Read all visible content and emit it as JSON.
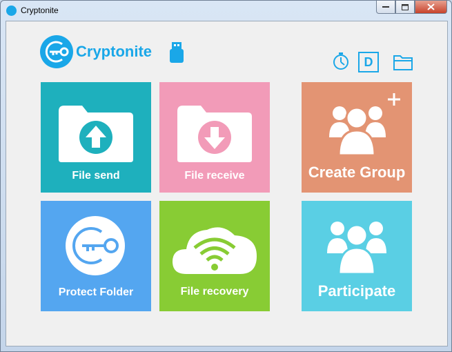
{
  "window": {
    "title": "Cryptonite"
  },
  "logo": {
    "text": "Cryptonite"
  },
  "toolbar": {
    "drive_letter": "D"
  },
  "tiles": {
    "file_send": "File send",
    "file_receive": "File receive",
    "create_group": "Create Group",
    "protect_folder": "Protect Folder",
    "file_recovery": "File recovery",
    "participate": "Participate"
  },
  "colors": {
    "brand": "#1aa7e8",
    "file_send": "#1eb0bd",
    "file_receive": "#f29bb8",
    "create_group": "#e39473",
    "protect_folder": "#54a6f0",
    "file_recovery": "#88cc34",
    "participate": "#5acfe4"
  }
}
